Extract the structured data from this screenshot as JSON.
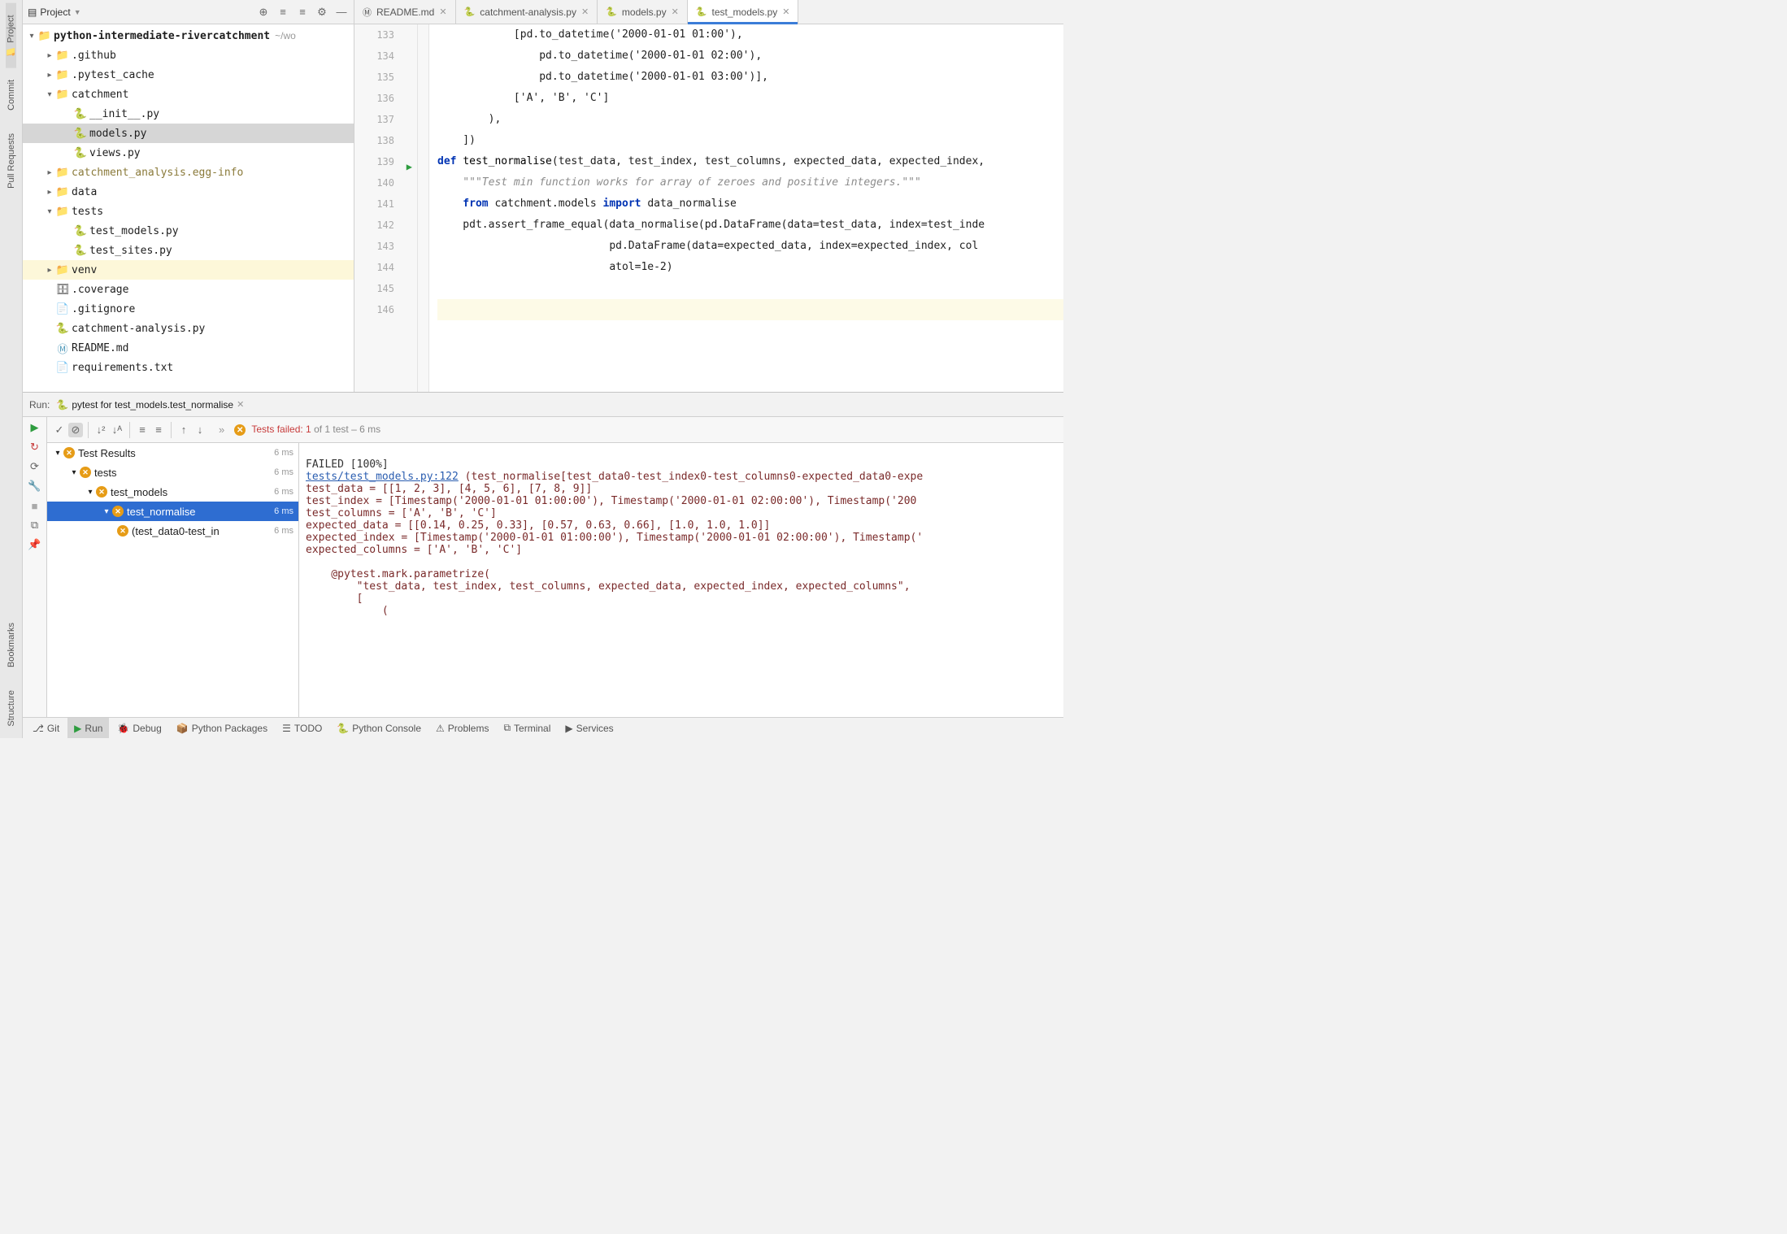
{
  "left_rail": {
    "items": [
      "Project",
      "Commit",
      "Pull Requests",
      "Bookmarks",
      "Structure"
    ]
  },
  "project_header": {
    "title": "Project"
  },
  "project_tree": {
    "root": {
      "label": "python-intermediate-rivercatchment",
      "hint": "~/wo"
    },
    "items": [
      {
        "label": ".github",
        "depth": 1,
        "arrow": "right",
        "icon": "folder"
      },
      {
        "label": ".pytest_cache",
        "depth": 1,
        "arrow": "right",
        "icon": "folder"
      },
      {
        "label": "catchment",
        "depth": 1,
        "arrow": "down",
        "icon": "folder"
      },
      {
        "label": "__init__.py",
        "depth": 2,
        "arrow": "",
        "icon": "py"
      },
      {
        "label": "models.py",
        "depth": 2,
        "arrow": "",
        "icon": "py",
        "selected": true
      },
      {
        "label": "views.py",
        "depth": 2,
        "arrow": "",
        "icon": "py"
      },
      {
        "label": "catchment_analysis.egg-info",
        "depth": 1,
        "arrow": "right",
        "icon": "folder",
        "muted": true
      },
      {
        "label": "data",
        "depth": 1,
        "arrow": "right",
        "icon": "folder"
      },
      {
        "label": "tests",
        "depth": 1,
        "arrow": "down",
        "icon": "folder"
      },
      {
        "label": "test_models.py",
        "depth": 2,
        "arrow": "",
        "icon": "py"
      },
      {
        "label": "test_sites.py",
        "depth": 2,
        "arrow": "",
        "icon": "py"
      },
      {
        "label": "venv",
        "depth": 1,
        "arrow": "right",
        "icon": "orange-folder",
        "highlighted": true
      },
      {
        "label": ".coverage",
        "depth": 1,
        "arrow": "",
        "icon": "db"
      },
      {
        "label": ".gitignore",
        "depth": 1,
        "arrow": "",
        "icon": "txt"
      },
      {
        "label": "catchment-analysis.py",
        "depth": 1,
        "arrow": "",
        "icon": "py"
      },
      {
        "label": "README.md",
        "depth": 1,
        "arrow": "",
        "icon": "md"
      },
      {
        "label": "requirements.txt",
        "depth": 1,
        "arrow": "",
        "icon": "txt"
      }
    ]
  },
  "tabs": [
    {
      "label": "README.md",
      "icon": "md"
    },
    {
      "label": "catchment-analysis.py",
      "icon": "py"
    },
    {
      "label": "models.py",
      "icon": "py"
    },
    {
      "label": "test_models.py",
      "icon": "py",
      "active": true
    }
  ],
  "gutter_lines": [
    "133",
    "134",
    "135",
    "136",
    "137",
    "138",
    "139",
    "140",
    "141",
    "142",
    "143",
    "144",
    "145",
    "146"
  ],
  "code": {
    "l133": "            [pd.to_datetime('2000-01-01 01:00'),",
    "l134": "                pd.to_datetime('2000-01-01 02:00'),",
    "l135": "                pd.to_datetime('2000-01-01 03:00')],",
    "l136": "            ['A', 'B', 'C']",
    "l137": "        ),",
    "l138": "    ])",
    "l139a": "def ",
    "l139b": "test_normalise",
    "l139c": "(test_data, test_index, test_columns, expected_data, expected_index,",
    "l140": "    \"\"\"Test min function works for array of zeroes and positive integers.\"\"\"",
    "l141a": "    from ",
    "l141b": "catchment.models ",
    "l141c": "import ",
    "l141d": "data_normalise",
    "l142": "    pdt.assert_frame_equal(data_normalise(pd.DataFrame(data=test_data, index=test_inde",
    "l143": "                           pd.DataFrame(data=expected_data, index=expected_index, col",
    "l144": "                           atol=1e-2)"
  },
  "run": {
    "label": "Run:",
    "config": "pytest for test_models.test_normalise",
    "status_fail": "Tests failed: 1",
    "status_rest": " of 1 test – 6 ms"
  },
  "test_tree": [
    {
      "label": "Test Results",
      "depth": 0,
      "time": "6 ms"
    },
    {
      "label": "tests",
      "depth": 1,
      "time": "6 ms"
    },
    {
      "label": "test_models",
      "depth": 2,
      "time": "6 ms"
    },
    {
      "label": "test_normalise",
      "depth": 3,
      "time": "6 ms",
      "selected": true
    },
    {
      "label": "(test_data0-test_in",
      "depth": 4,
      "time": "6 ms"
    }
  ],
  "output": {
    "l1": "FAILED [100%]",
    "l2a": "tests/test_models.py:122",
    "l2b": " (test_normalise[test_data0-test_index0-test_columns0-expected_data0-expe",
    "l3": "test_data = [[1, 2, 3], [4, 5, 6], [7, 8, 9]]",
    "l4": "test_index = [Timestamp('2000-01-01 01:00:00'), Timestamp('2000-01-01 02:00:00'), Timestamp('200",
    "l5": "test_columns = ['A', 'B', 'C']",
    "l6": "expected_data = [[0.14, 0.25, 0.33], [0.57, 0.63, 0.66], [1.0, 1.0, 1.0]]",
    "l7": "expected_index = [Timestamp('2000-01-01 01:00:00'), Timestamp('2000-01-01 02:00:00'), Timestamp('",
    "l8": "expected_columns = ['A', 'B', 'C']",
    "l9": "",
    "l10": "    @pytest.mark.parametrize(",
    "l11": "        \"test_data, test_index, test_columns, expected_data, expected_index, expected_columns\",",
    "l12": "        [",
    "l13": "            ("
  },
  "bottom": {
    "git": "Git",
    "run": "Run",
    "debug": "Debug",
    "packages": "Python Packages",
    "todo": "TODO",
    "console": "Python Console",
    "problems": "Problems",
    "terminal": "Terminal",
    "services": "Services"
  }
}
